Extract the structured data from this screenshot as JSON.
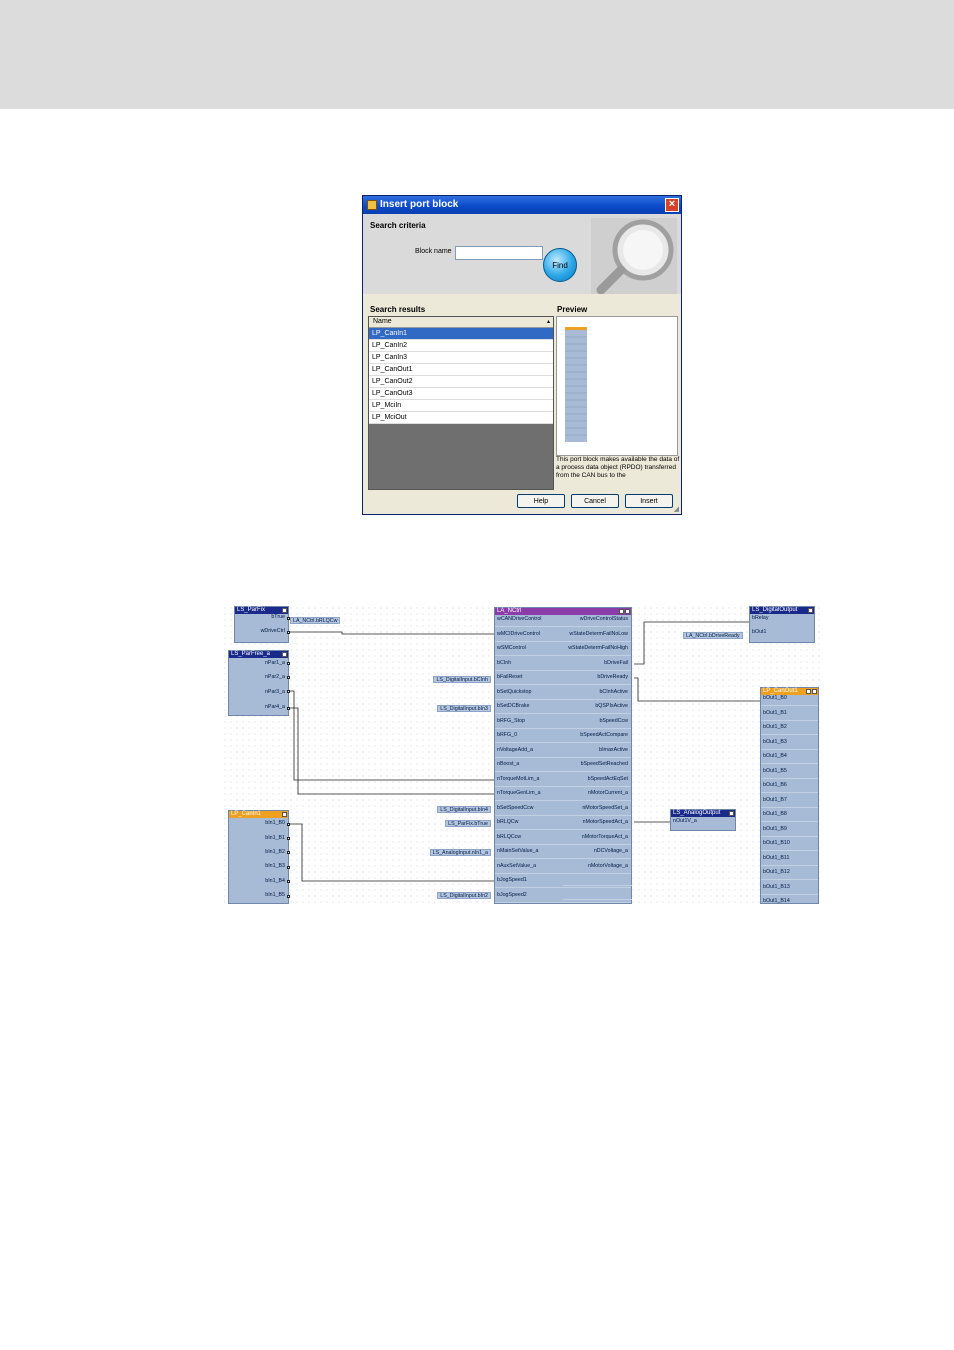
{
  "dialog": {
    "title": "Insert port block",
    "search_criteria_label": "Search criteria",
    "block_name_label": "Block name",
    "block_name_value": "",
    "find_button": "Find",
    "search_results_label": "Search results",
    "column_header": "Name",
    "results": [
      "LP_CanIn1",
      "LP_CanIn2",
      "LP_CanIn3",
      "LP_CanOut1",
      "LP_CanOut2",
      "LP_CanOut3",
      "LP_MciIn",
      "LP_MciOut"
    ],
    "selected_index": 0,
    "preview_label": "Preview",
    "preview_description": "This port block makes available the data of a process data object (RPDO) transferred from the CAN bus to the",
    "buttons": {
      "help": "Help",
      "cancel": "Cancel",
      "insert": "Insert"
    },
    "selection_color": "#316ac5"
  },
  "diagram": {
    "ls_parfix": {
      "title": "LS_ParFix",
      "pins": [
        "bTrue",
        "wDriveCtrl"
      ],
      "signal": "LA_NCtrl.bRLQCw"
    },
    "ls_parfree": {
      "title": "LS_ParFree_a",
      "pins": [
        "nPar1_a",
        "nPar2_a",
        "nPar3_a",
        "nPar4_a"
      ]
    },
    "lp_canin1": {
      "title": "LP_CanIn1",
      "pins": [
        "bIn1_B0",
        "bIn1_B1",
        "bIn1_B2",
        "bIn1_B3",
        "bIn1_B4",
        "bIn1_B5"
      ],
      "header_color": "#f0a020"
    },
    "la_nctrl": {
      "title": "LA_NCtrl",
      "header_color": "#8040a0",
      "inputs": [
        "wCANDriveControl",
        "wMCIDriveControl",
        "wSMControl",
        "bCInh",
        "bFailReset",
        "bSetQuickstop",
        "bSetDCBrake",
        "bRFG_Stop",
        "bRFG_0",
        "nVoltageAdd_a",
        "nBoost_a",
        "nTorqueMotLim_a",
        "nTorqueGenLim_a",
        "bSetSpeedCcw",
        "bRLQCw",
        "bRLQCcw",
        "nMainSetValue_a",
        "nAuxSetValue_a",
        "bJogSpeed1",
        "bJogSpeed2"
      ],
      "outputs": [
        "wDriveControlStatus",
        "wStateDetermFailNoLow",
        "wStateDetermFailNoHigh",
        "bDriveFail",
        "bDriveReady",
        "bCInhActive",
        "bQSPIsActive",
        "bSpeedCcw",
        "bSpeedActCompare",
        "bImaxActive",
        "bSpeedSetReached",
        "bSpeedActEqSet",
        "nMotorCurrent_a",
        "nMotorSpeedSet_a",
        "nMotorSpeedAct_a",
        "nMotorTorqueAct_a",
        "nDCVoltage_a",
        "nMotorVoltage_a"
      ]
    },
    "input_signals": [
      {
        "label": "LS_DigitalInput.bCInh",
        "row": 4
      },
      {
        "label": "LS_DigitalInput.bIn3",
        "row": 6
      },
      {
        "label": "LS_DigitalInput.bIn4",
        "row": 13
      },
      {
        "label": "LS_ParFix.bTrue",
        "row": 14
      },
      {
        "label": "LS_AnalogInput.nIn1_a",
        "row": 16
      },
      {
        "label": "LS_DigitalInput.bIn2",
        "row": 19
      }
    ],
    "ls_digitaloutput": {
      "title": "LS_DigitalOutput",
      "pins": [
        "bRelay",
        "bOut1"
      ],
      "signal": "LA_NCtrl.bDriveReady"
    },
    "ls_analogoutput": {
      "title": "LS_AnalogOutput",
      "pins": [
        "nOut1V_a"
      ]
    },
    "lp_canout1": {
      "title": "LP_CanOut1",
      "header_color": "#f0a020",
      "pins": [
        "bOut1_B0",
        "bOut1_B1",
        "bOut1_B2",
        "bOut1_B3",
        "bOut1_B4",
        "bOut1_B5",
        "bOut1_B6",
        "bOut1_B7",
        "bOut1_B8",
        "bOut1_B9",
        "bOut1_B10",
        "bOut1_B11",
        "bOut1_B12",
        "bOut1_B13",
        "bOut1_B14"
      ]
    }
  }
}
